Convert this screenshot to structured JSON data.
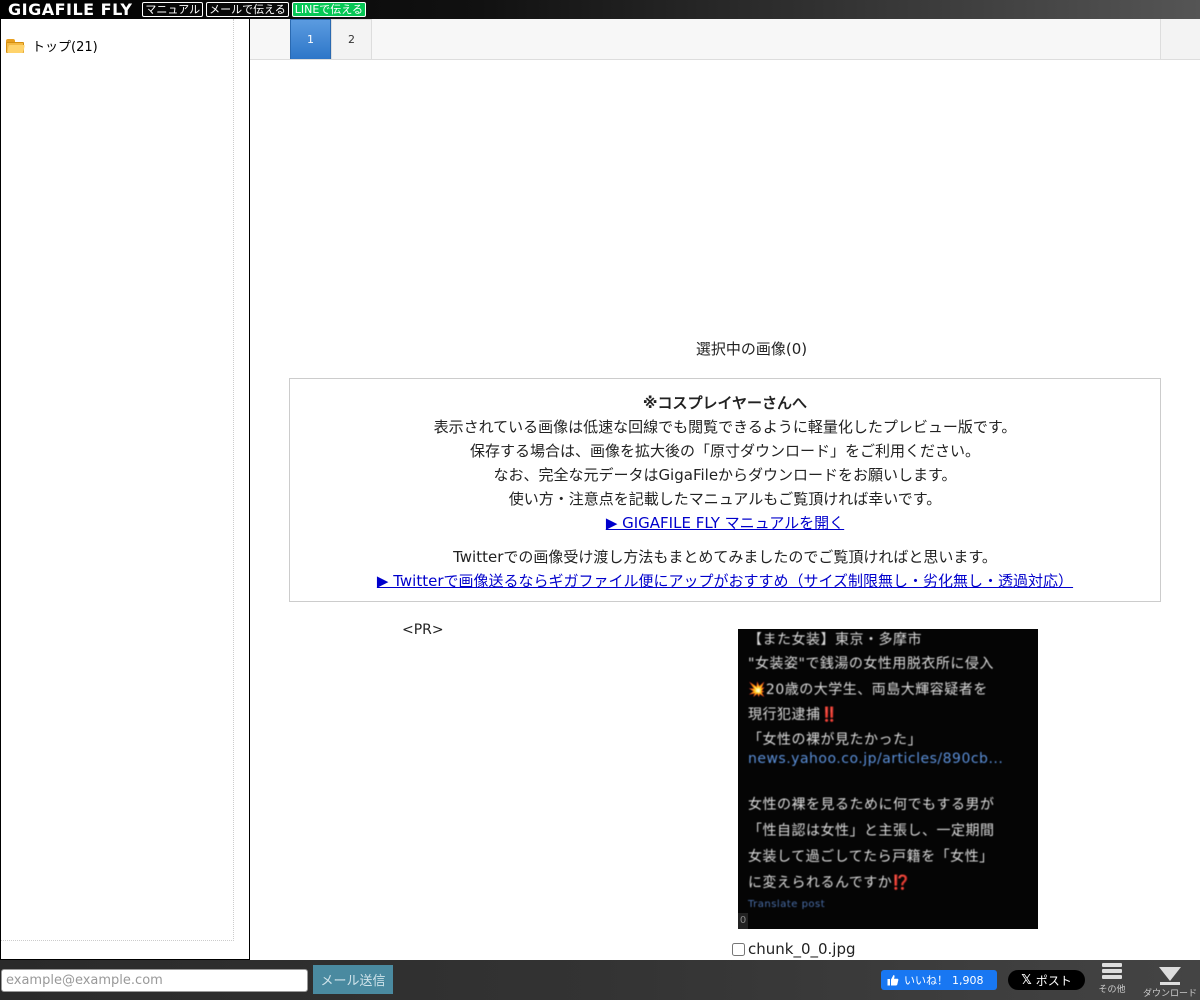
{
  "header": {
    "logo": "GIGAFILE FLY",
    "links": [
      "マニュアル",
      "メールで伝える",
      "LINEで伝える"
    ]
  },
  "sidebar": {
    "tree": [
      {
        "label": "トップ(21)",
        "icon": "folder-icon"
      }
    ]
  },
  "pagination": {
    "tabs": [
      {
        "label": "1",
        "active": true
      },
      {
        "label": "2",
        "active": false
      }
    ]
  },
  "main": {
    "selected_count": "選択中の画像(0)",
    "notice": {
      "title": "※コスプレイヤーさんへ",
      "lines": [
        "表示されている画像は低速な回線でも閲覧できるように軽量化したプレビュー版です。",
        "保存する場合は、画像を拡大後の「原寸ダウンロード」をご利用ください。",
        "なお、完全な元データはGigaFileからダウンロードをお願いします。",
        "使い方・注意点を記載したマニュアルもご覧頂ければ幸いです。"
      ],
      "manual_link": "▶ GIGAFILE FLY マニュアルを開く",
      "twitter_text": "Twitterでの画像受け渡し方法もまとめてみましたのでご覧頂ければと思います。",
      "twitter_link": "▶ Twitterで画像送るならギガファイル便にアップがおすすめ（サイズ制限無し・劣化無し・透過対応）"
    },
    "pr_label": "<PR>",
    "thumbnail": {
      "lines": [
        "【また女装】東京・多摩市",
        "\"女装姿\"で銭湯の女性用脱衣所に侵入",
        "💥20歳の大学生、両島大輝容疑者を",
        "現行犯逮捕‼️",
        "「女性の裸が見たかった」",
        "news.yahoo.co.jp/articles/890cb...",
        "女性の裸を見るために何でもする男が",
        "「性自認は女性」と主張し、一定期間",
        "女装して過ごしてたら戸籍を「女性」",
        "に変えられるんですか⁉️",
        "Translate post"
      ],
      "badge": "0"
    },
    "file_name": "chunk_0_0.jpg"
  },
  "footer": {
    "email_placeholder": "example@example.com",
    "mail_send": "メール送信",
    "like_label": "いいね！",
    "like_count": "1,908",
    "post_label": "ポスト",
    "other_label": "その他",
    "download_label": "ダウンロード"
  },
  "colors": {
    "active_tab": "#2d76c8",
    "link": "#0000cc",
    "facebook": "#1877f2",
    "line": "#06c755"
  }
}
